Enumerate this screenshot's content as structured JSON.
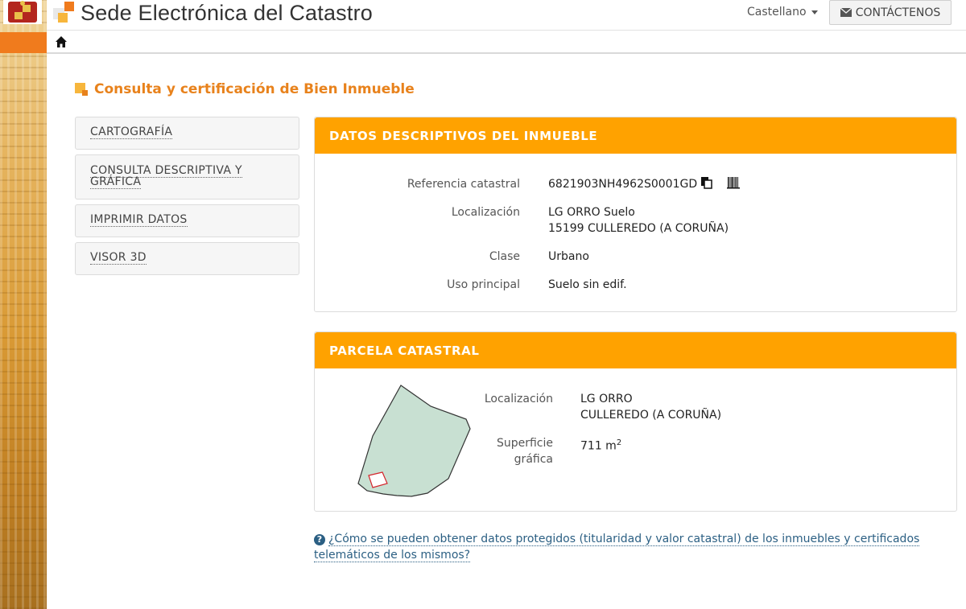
{
  "header": {
    "site_title": "Sede Electrónica del Catastro",
    "language": "Castellano",
    "contact_label": "CONTÁCTENOS"
  },
  "page": {
    "title": "Consulta y certificación de Bien Inmueble"
  },
  "menu": {
    "items": [
      {
        "label": "CARTOGRAFÍA"
      },
      {
        "label": "CONSULTA DESCRIPTIVA Y GRÁFICA"
      },
      {
        "label": "IMPRIMIR DATOS"
      },
      {
        "label": "VISOR 3D"
      }
    ]
  },
  "datos": {
    "title": "DATOS DESCRIPTIVOS DEL INMUEBLE",
    "referencia_label": "Referencia catastral",
    "referencia_value": "6821903NH4962S0001GD",
    "localizacion_label": "Localización",
    "localizacion_line1": "LG ORRO Suelo",
    "localizacion_line2": "15199 CULLEREDO (A CORUÑA)",
    "clase_label": "Clase",
    "clase_value": "Urbano",
    "uso_label": "Uso principal",
    "uso_value": "Suelo sin edif."
  },
  "parcela": {
    "title": "PARCELA CATASTRAL",
    "localizacion_label": "Localización",
    "localizacion_line1": "LG ORRO",
    "localizacion_line2": "CULLEREDO (A CORUÑA)",
    "superficie_label_1": "Superficie",
    "superficie_label_2": "gráfica",
    "superficie_value": "711 m",
    "superficie_unit_sup": "2"
  },
  "help": {
    "text": "¿Cómo se pueden obtener datos protegidos (titularidad y valor catastral) de los inmuebles y certificados telemáticos de los mismos?"
  },
  "colors": {
    "accent_orange": "#ffa200",
    "title_orange": "#e8821c",
    "link_blue": "#2b5f83",
    "parcel_fill": "#c8e0d2"
  }
}
